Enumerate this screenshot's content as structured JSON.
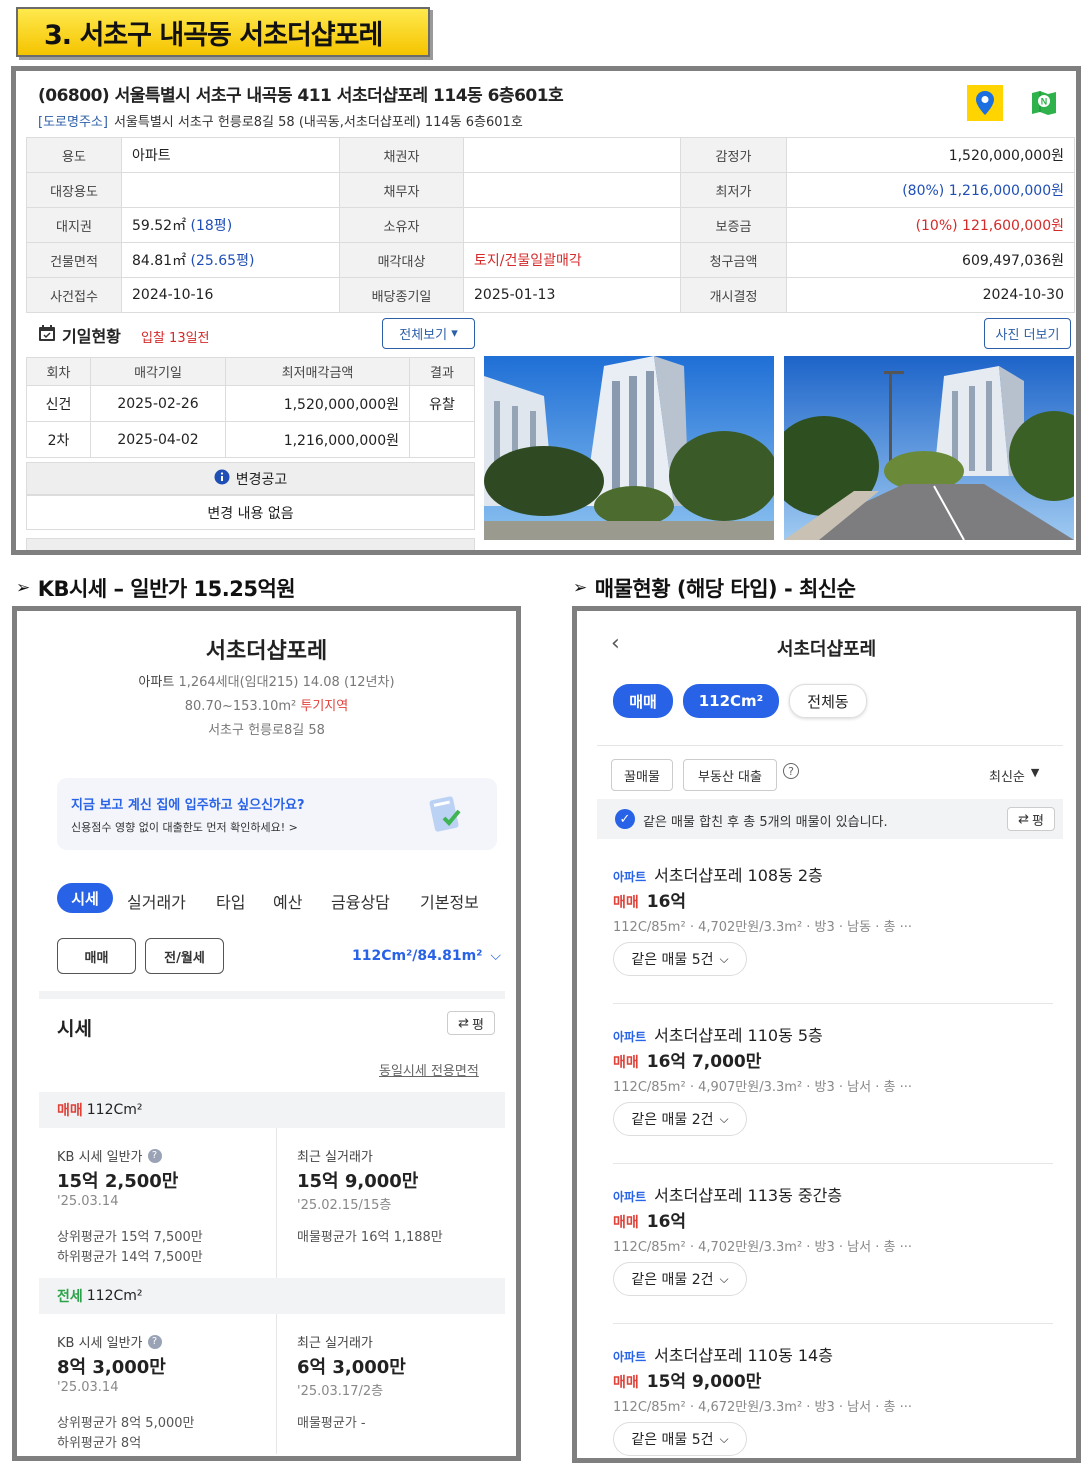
{
  "page_title": "3. 서초구 내곡동 서초더샵포레",
  "court": {
    "address_main": "(06800) 서울특별시 서초구 내곡동 411 서초더샵포레 114동 6층601호",
    "road_tag": "[도로명주소]",
    "road_address": "서울특별시 서초구 헌릉로8길 58 (내곡동,서초더샵포레) 114동 6층601호",
    "map_icon": "map-pin-icon",
    "naver_map_icon": "naver-map-icon",
    "rows": [
      {
        "l1": "용도",
        "v1": "아파트",
        "l2": "채권자",
        "v2": "",
        "l3": "감정가",
        "v3": "1,520,000,000원"
      },
      {
        "l1": "대장용도",
        "v1": "",
        "l2": "채무자",
        "v2": "",
        "l3": "최저가",
        "v3": "(80%) 1,216,000,000원"
      },
      {
        "l1": "대지권",
        "v1": "59.52㎡ ",
        "v1b": "(18평)",
        "l2": "소유자",
        "v2": "",
        "l3": "보증금",
        "v3": "(10%) 121,600,000원"
      },
      {
        "l1": "건물면적",
        "v1": "84.81㎡ ",
        "v1b": "(25.65평)",
        "l2": "매각대상",
        "v2": "토지/건물일괄매각",
        "l3": "청구금액",
        "v3": "609,497,036원"
      },
      {
        "l1": "사건접수",
        "v1": "2024-10-16",
        "l2": "배당종기일",
        "v2": "2025-01-13",
        "l3": "개시결정",
        "v3": "2024-10-30"
      }
    ],
    "schedule_title": "기일현황",
    "schedule_sub": "입찰 13일전",
    "view_all": "전체보기",
    "more_photos": "사진 더보기",
    "schedule_headers": [
      "회차",
      "매각기일",
      "최저매각금액",
      "결과"
    ],
    "schedule_rows": [
      {
        "round": "신건",
        "date": "2025-02-26",
        "price": "1,520,000,000원",
        "result": "유찰"
      },
      {
        "round": "2차",
        "date": "2025-04-02",
        "price": "1,216,000,000원",
        "result": ""
      }
    ],
    "notice_title": "변경공고",
    "notice_body": "변경 내용 없음"
  },
  "kb_heading": "KB시세 – 일반가 15.25억원",
  "listing_heading": "매물현황 (해당 타입) - 최신순",
  "kb": {
    "name": "서초더샵포레",
    "info1a": "아파트",
    "info1b": "1,264세대(임대215) 14.08 (12년차)",
    "info2a": "80.70~153.10m²",
    "info2b": "투기지역",
    "info3": "서초구 헌릉로8길 58",
    "loan_title": "지금 보고 계신 집에 입주하고 싶으신가요?",
    "loan_sub": "신용점수 영향 없이 대출한도 먼저 확인하세요! >",
    "tabs": [
      "시세",
      "실거래가",
      "타입",
      "예산",
      "금융상담",
      "기본정보"
    ],
    "btn_sale": "매매",
    "btn_rent": "전/월세",
    "area_select": "112Cm²/84.81m²",
    "section_title": "시세",
    "unit_btn": "평",
    "same_price_link": "동일시세 전용면적",
    "sale": {
      "tag": "매매",
      "type": "112Cm²",
      "kb_label": "KB 시세 일반가",
      "kb_value": "15억 2,500만",
      "kb_date": "'25.03.14",
      "recent_label": "최근 실거래가",
      "recent_value": "15억 9,000만",
      "recent_date": "'25.02.15/15층",
      "upper": "상위평균가 15억 7,500만",
      "lower": "하위평균가 14억 7,500만",
      "listing_avg": "매물평균가 16억 1,188만"
    },
    "jeonse": {
      "tag": "전세",
      "type": "112Cm²",
      "kb_label": "KB 시세 일반가",
      "kb_value": "8억 3,000만",
      "kb_date": "'25.03.14",
      "recent_label": "최근 실거래가",
      "recent_value": "6억 3,000만",
      "recent_date": "'25.03.17/2층",
      "upper": "상위평균가 8억 5,000만",
      "lower": "하위평균가 8억",
      "listing_avg": "매물평균가 -"
    }
  },
  "listings": {
    "title": "서초더샵포레",
    "filter_sale": "매매",
    "filter_type": "112Cm²",
    "filter_dong": "전체동",
    "chip1": "꿀매물",
    "chip2": "부동산 대출",
    "sort": "최신순",
    "merged_note": "같은 매물 합친 후 총 5개의 매물이 있습니다.",
    "unit_btn": "평",
    "items": [
      {
        "type": "아파트",
        "name": "서초더샵포레 108동 2층",
        "deal": "매매",
        "price": "16억",
        "desc": "112C/85m² · 4,702만원/3.3m² · 방3 · 남동 · 총 ···",
        "same": "같은 매물 5건"
      },
      {
        "type": "아파트",
        "name": "서초더샵포레 110동 5층",
        "deal": "매매",
        "price": "16억 7,000만",
        "desc": "112C/85m² · 4,907만원/3.3m² · 방3 · 남서 · 총 ···",
        "same": "같은 매물 2건"
      },
      {
        "type": "아파트",
        "name": "서초더샵포레 113동 중간층",
        "deal": "매매",
        "price": "16억",
        "desc": "112C/85m² · 4,702만원/3.3m² · 방3 · 남서 · 총 ···",
        "same": "같은 매물 2건"
      },
      {
        "type": "아파트",
        "name": "서초더샵포레 110동 14층",
        "deal": "매매",
        "price": "15억 9,000만",
        "desc": "112C/85m² · 4,672만원/3.3m² · 방3 · 남서 · 총 ···",
        "same": "같은 매물 5건"
      }
    ]
  }
}
